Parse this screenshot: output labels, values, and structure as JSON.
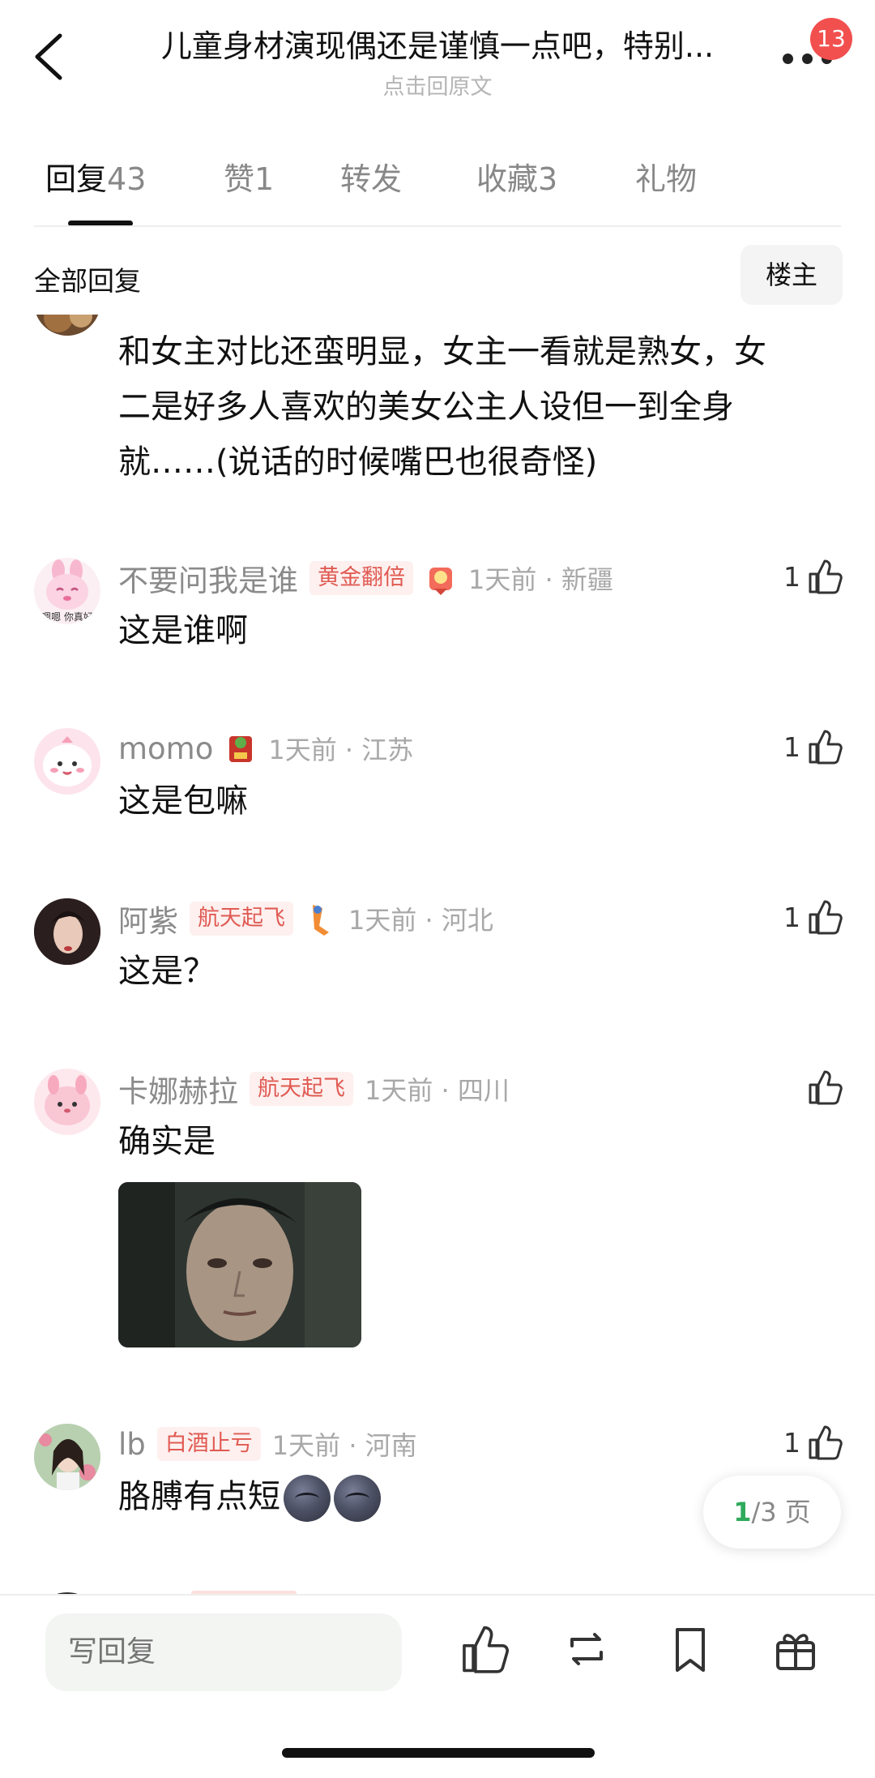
{
  "header": {
    "title": "儿童身材演现偶还是谨慎一点吧，特别...",
    "subtitle": "点击回原文",
    "badge": "13"
  },
  "tabs": [
    {
      "label": "回复",
      "count": "43",
      "active": true
    },
    {
      "label": "赞",
      "count": "1",
      "active": false
    },
    {
      "label": "转发",
      "count": "",
      "active": false
    },
    {
      "label": "收藏",
      "count": "3",
      "active": false
    },
    {
      "label": "礼物",
      "count": "",
      "active": false
    }
  ],
  "filter": {
    "all_label": "全部回复",
    "host_label": "楼主"
  },
  "top_comment": {
    "lines": [
      "和女主对比还蛮明显，女主一看就是熟女，女",
      "二是好多人喜欢的美女公主人设但一到全身",
      "就……(说话的时候嘴巴也很奇怪)"
    ]
  },
  "comments": [
    {
      "name": "不要问我是谁",
      "tag": "黄金翻倍",
      "time": "1天前 · 新疆",
      "likes": "1",
      "text": "这是谁啊",
      "avatar_label": "嗯嗯 你真好"
    },
    {
      "name": "momo",
      "tag": "",
      "time": "1天前 · 江苏",
      "likes": "1",
      "text": "这是包嘛"
    },
    {
      "name": "阿紫",
      "tag": "航天起飞",
      "time": "1天前 · 河北",
      "likes": "1",
      "text": "这是？"
    },
    {
      "name": "卡娜赫拉",
      "tag": "航天起飞",
      "time": "1天前 · 四川",
      "likes": "",
      "text": "确实是"
    },
    {
      "name": "lb",
      "tag": "白酒止亏",
      "time": "1天前 · 河南",
      "likes": "1",
      "text": "胳膊有点短"
    }
  ],
  "pager": {
    "current": "1",
    "total_text": "/3 页"
  },
  "bottom": {
    "input_placeholder": "写回复"
  },
  "colors": {
    "accent_green": "#2faa5c",
    "tag_red": "#e05a52",
    "badge_red": "#f24f4f"
  },
  "icons": [
    "back-icon",
    "more-icon",
    "like-icon",
    "repost-icon",
    "bookmark-icon",
    "gift-icon"
  ]
}
